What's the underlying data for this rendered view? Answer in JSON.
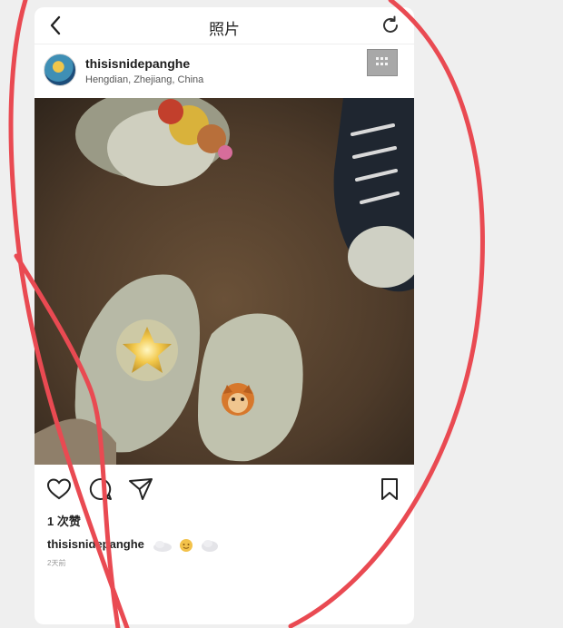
{
  "topbar": {
    "title": "照片"
  },
  "post": {
    "username": "thisisnidepanghe",
    "location": "Hengdian, Zhejiang, China",
    "likes": "1 次赞",
    "caption_user": "thisisnidepanghe",
    "time": "2天前"
  },
  "colors": {
    "annotation": "#e94a52",
    "text": "#222222",
    "muted": "#9a9a9a"
  },
  "icons": [
    "back-arrow-icon",
    "refresh-icon",
    "more-icon",
    "heart-icon",
    "comment-icon",
    "share-icon",
    "bookmark-icon"
  ]
}
